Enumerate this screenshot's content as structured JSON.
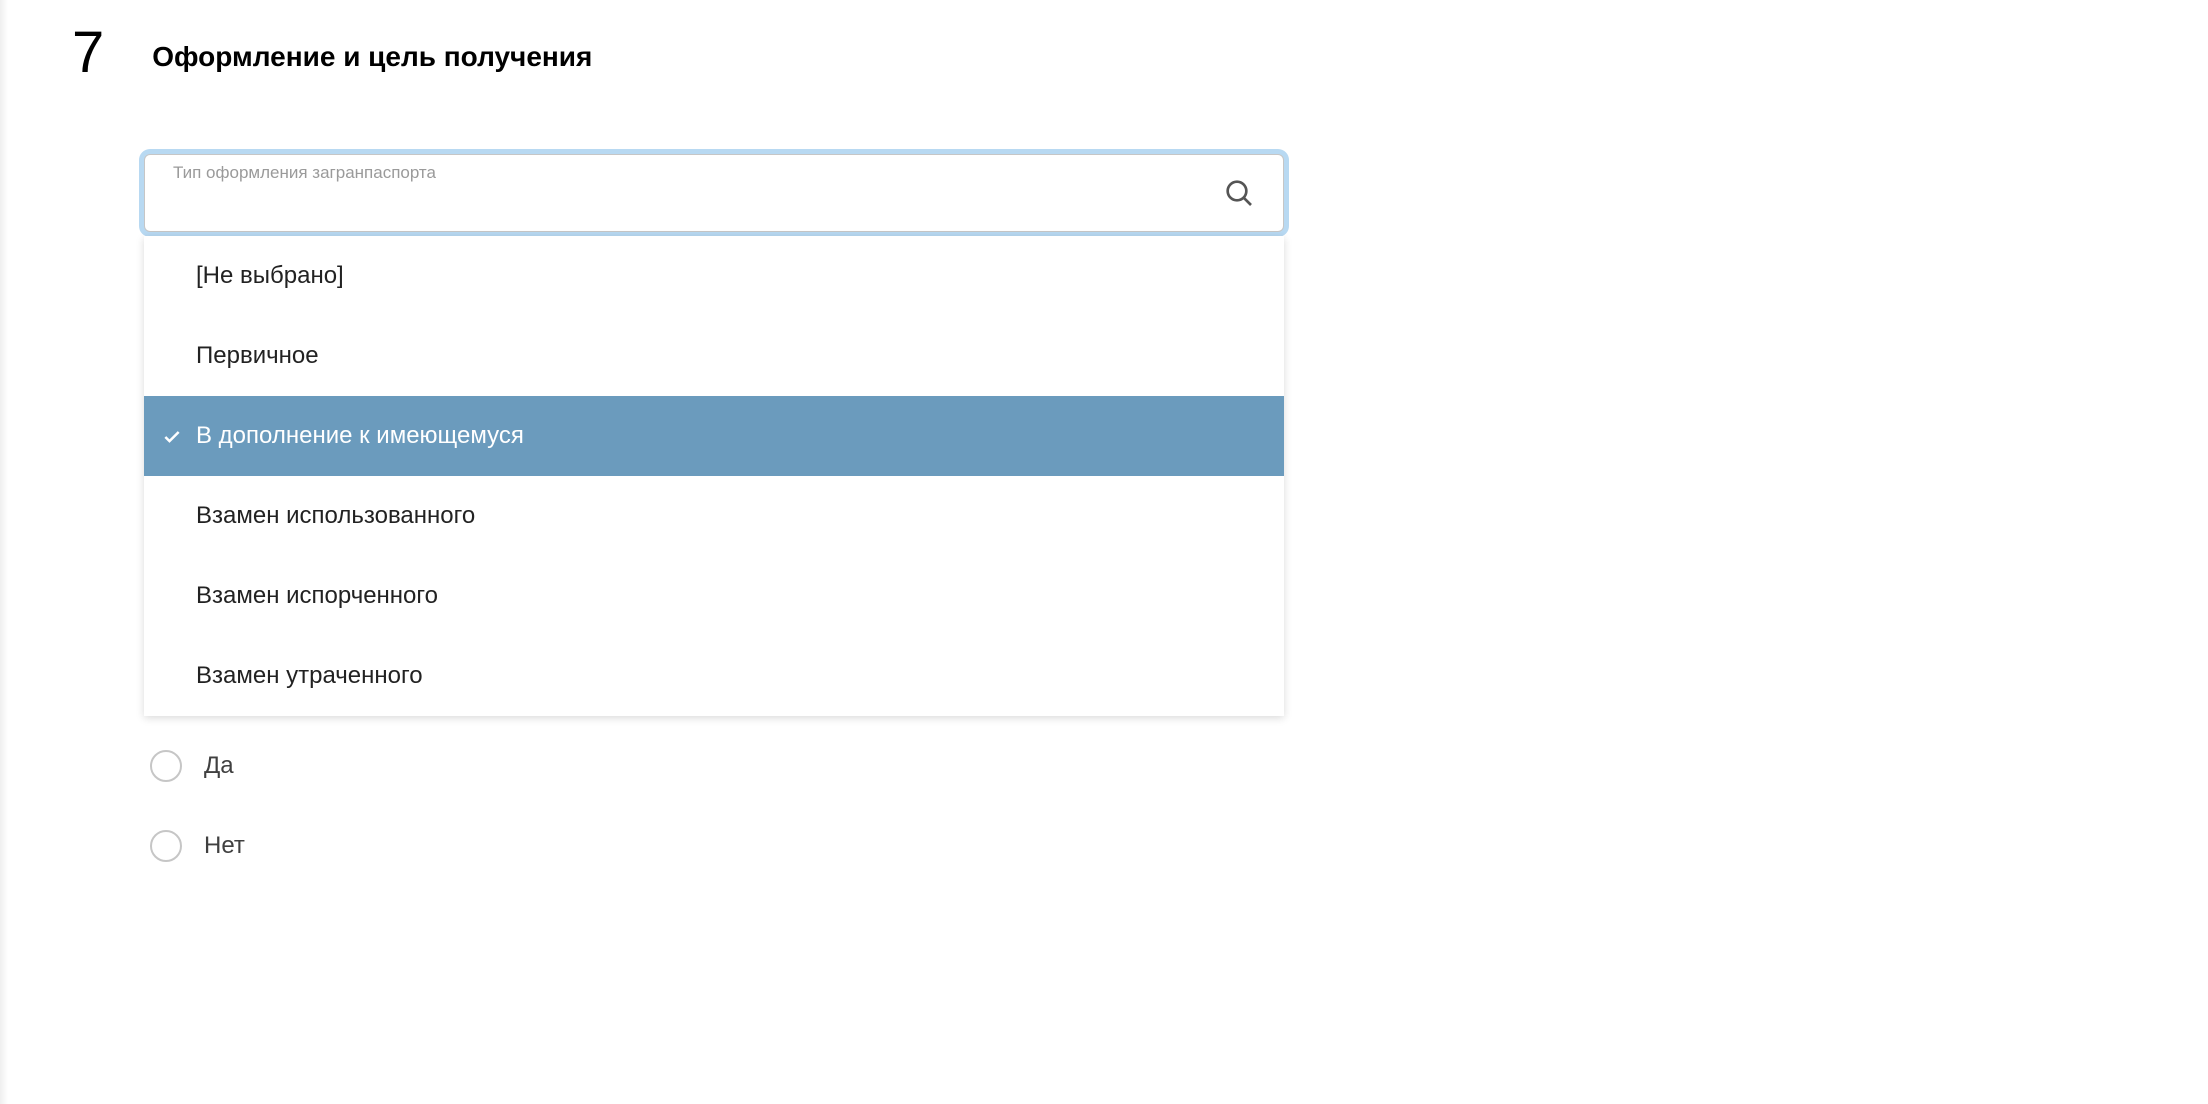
{
  "step": {
    "number": "7",
    "title": "Оформление и цель получения"
  },
  "select": {
    "label": "Тип оформления загранпаспорта",
    "value": "",
    "options": [
      {
        "label": "[Не выбрано]",
        "selected": false
      },
      {
        "label": "Первичное",
        "selected": false
      },
      {
        "label": "В дополнение к имеющемуся",
        "selected": true
      },
      {
        "label": "Взамен использованного",
        "selected": false
      },
      {
        "label": "Взамен испорченного",
        "selected": false
      },
      {
        "label": "Взамен утраченного",
        "selected": false
      }
    ]
  },
  "radios": [
    {
      "label": "Да"
    },
    {
      "label": "Нет"
    }
  ]
}
